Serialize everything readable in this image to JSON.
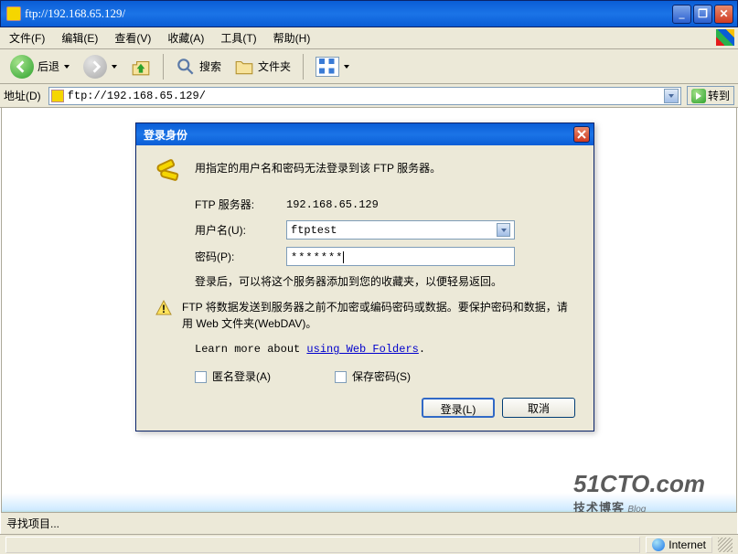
{
  "window": {
    "title": "ftp://192.168.65.129/"
  },
  "menu": {
    "file": "文件(F)",
    "edit": "编辑(E)",
    "view": "查看(V)",
    "favorites": "收藏(A)",
    "tools": "工具(T)",
    "help": "帮助(H)"
  },
  "toolbar": {
    "back": "后退",
    "search": "搜索",
    "folders": "文件夹"
  },
  "addressbar": {
    "label": "地址(D)",
    "value": "ftp://192.168.65.129/",
    "go": "转到"
  },
  "dialog": {
    "title": "登录身份",
    "message": "用指定的用户名和密码无法登录到该 FTP 服务器。",
    "server_label": "FTP 服务器:",
    "server_value": "192.168.65.129",
    "user_label": "用户名(U):",
    "user_value": "ftptest",
    "pwd_label": "密码(P):",
    "pwd_value": "*******",
    "note": "登录后，可以将这个服务器添加到您的收藏夹，以便轻易返回。",
    "warning": "FTP 将数据发送到服务器之前不加密或编码密码或数据。要保护密码和数据，请用 Web 文件夹(WebDAV)。",
    "learn_prefix": "Learn more about ",
    "learn_link": "using Web Folders",
    "anon": "匿名登录(A)",
    "save": "保存密码(S)",
    "login": "登录(L)",
    "cancel": "取消"
  },
  "status": {
    "zone": "Internet"
  },
  "findbar": {
    "label": "寻找项目..."
  },
  "watermark": {
    "brand": "51CTO.com",
    "sub": "技术博客",
    "blog": "Blog"
  }
}
